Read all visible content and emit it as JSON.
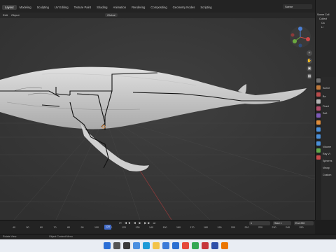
{
  "workspace_tabs": [
    "Layout",
    "Modeling",
    "Sculpting",
    "UV Editing",
    "Texture Paint",
    "Shading",
    "Animation",
    "Rendering",
    "Compositing",
    "Geometry Nodes",
    "Scripting"
  ],
  "active_tab": "Layout",
  "scene": {
    "label": "Scene"
  },
  "header": {
    "edit": "Edit",
    "object": "Object",
    "transform": "Global"
  },
  "viewport": {
    "options_label": "Options"
  },
  "outliner": {
    "rows": [
      "Scene Coll",
      "Collect",
      "Ca",
      "Li"
    ]
  },
  "properties": {
    "rows": [
      "Scene",
      "Ba",
      "Fixed",
      "Soft",
      "Volume",
      "Ray Vi",
      "Spheres",
      "Viewp",
      "Custom"
    ]
  },
  "timeline": {
    "ticks": [
      "40",
      "50",
      "60",
      "70",
      "80",
      "90",
      "100",
      "110",
      "120",
      "130",
      "140",
      "150",
      "160",
      "170",
      "180",
      "190",
      "200",
      "210",
      "220",
      "230",
      "240",
      "250"
    ],
    "current_frame": "120",
    "playback_label": "Playback",
    "keying_label": "Keying",
    "view_label": "View",
    "marker_label": "Marker",
    "frame_value": "1",
    "start_label": "Start",
    "start_value": "1",
    "end_label": "End",
    "end_value": "250"
  },
  "status": {
    "left": "Rotate View",
    "right": "Object Context Menu"
  },
  "taskbar": {
    "time": "",
    "icons": [
      {
        "name": "windows-icon",
        "color": "#2b6fd6"
      },
      {
        "name": "search-icon",
        "color": "#555555"
      },
      {
        "name": "task-view-icon",
        "color": "#3a3a3a"
      },
      {
        "name": "widgets-icon",
        "color": "#4a8fe0"
      },
      {
        "name": "edge-icon",
        "color": "#1e9bd7"
      },
      {
        "name": "explorer-icon",
        "color": "#f2c34a"
      },
      {
        "name": "store-icon",
        "color": "#3b7ad8"
      },
      {
        "name": "mail-icon",
        "color": "#2a6fd1"
      },
      {
        "name": "chrome-icon",
        "color": "#e5493a"
      },
      {
        "name": "app-green-icon",
        "color": "#33a852"
      },
      {
        "name": "app-red-icon",
        "color": "#c7353a"
      },
      {
        "name": "app-blue-icon",
        "color": "#2d4fa8"
      },
      {
        "name": "blender-icon",
        "color": "#ea7600"
      }
    ]
  }
}
